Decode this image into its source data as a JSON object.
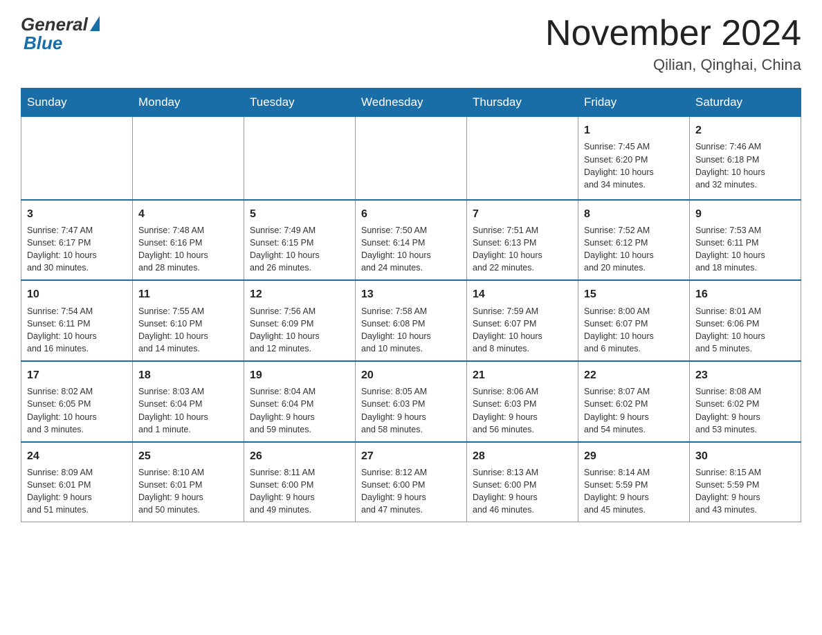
{
  "header": {
    "logo_general": "General",
    "logo_blue": "Blue",
    "month_title": "November 2024",
    "location": "Qilian, Qinghai, China"
  },
  "days_of_week": [
    "Sunday",
    "Monday",
    "Tuesday",
    "Wednesday",
    "Thursday",
    "Friday",
    "Saturday"
  ],
  "weeks": [
    [
      {
        "day": "",
        "info": ""
      },
      {
        "day": "",
        "info": ""
      },
      {
        "day": "",
        "info": ""
      },
      {
        "day": "",
        "info": ""
      },
      {
        "day": "",
        "info": ""
      },
      {
        "day": "1",
        "info": "Sunrise: 7:45 AM\nSunset: 6:20 PM\nDaylight: 10 hours\nand 34 minutes."
      },
      {
        "day": "2",
        "info": "Sunrise: 7:46 AM\nSunset: 6:18 PM\nDaylight: 10 hours\nand 32 minutes."
      }
    ],
    [
      {
        "day": "3",
        "info": "Sunrise: 7:47 AM\nSunset: 6:17 PM\nDaylight: 10 hours\nand 30 minutes."
      },
      {
        "day": "4",
        "info": "Sunrise: 7:48 AM\nSunset: 6:16 PM\nDaylight: 10 hours\nand 28 minutes."
      },
      {
        "day": "5",
        "info": "Sunrise: 7:49 AM\nSunset: 6:15 PM\nDaylight: 10 hours\nand 26 minutes."
      },
      {
        "day": "6",
        "info": "Sunrise: 7:50 AM\nSunset: 6:14 PM\nDaylight: 10 hours\nand 24 minutes."
      },
      {
        "day": "7",
        "info": "Sunrise: 7:51 AM\nSunset: 6:13 PM\nDaylight: 10 hours\nand 22 minutes."
      },
      {
        "day": "8",
        "info": "Sunrise: 7:52 AM\nSunset: 6:12 PM\nDaylight: 10 hours\nand 20 minutes."
      },
      {
        "day": "9",
        "info": "Sunrise: 7:53 AM\nSunset: 6:11 PM\nDaylight: 10 hours\nand 18 minutes."
      }
    ],
    [
      {
        "day": "10",
        "info": "Sunrise: 7:54 AM\nSunset: 6:11 PM\nDaylight: 10 hours\nand 16 minutes."
      },
      {
        "day": "11",
        "info": "Sunrise: 7:55 AM\nSunset: 6:10 PM\nDaylight: 10 hours\nand 14 minutes."
      },
      {
        "day": "12",
        "info": "Sunrise: 7:56 AM\nSunset: 6:09 PM\nDaylight: 10 hours\nand 12 minutes."
      },
      {
        "day": "13",
        "info": "Sunrise: 7:58 AM\nSunset: 6:08 PM\nDaylight: 10 hours\nand 10 minutes."
      },
      {
        "day": "14",
        "info": "Sunrise: 7:59 AM\nSunset: 6:07 PM\nDaylight: 10 hours\nand 8 minutes."
      },
      {
        "day": "15",
        "info": "Sunrise: 8:00 AM\nSunset: 6:07 PM\nDaylight: 10 hours\nand 6 minutes."
      },
      {
        "day": "16",
        "info": "Sunrise: 8:01 AM\nSunset: 6:06 PM\nDaylight: 10 hours\nand 5 minutes."
      }
    ],
    [
      {
        "day": "17",
        "info": "Sunrise: 8:02 AM\nSunset: 6:05 PM\nDaylight: 10 hours\nand 3 minutes."
      },
      {
        "day": "18",
        "info": "Sunrise: 8:03 AM\nSunset: 6:04 PM\nDaylight: 10 hours\nand 1 minute."
      },
      {
        "day": "19",
        "info": "Sunrise: 8:04 AM\nSunset: 6:04 PM\nDaylight: 9 hours\nand 59 minutes."
      },
      {
        "day": "20",
        "info": "Sunrise: 8:05 AM\nSunset: 6:03 PM\nDaylight: 9 hours\nand 58 minutes."
      },
      {
        "day": "21",
        "info": "Sunrise: 8:06 AM\nSunset: 6:03 PM\nDaylight: 9 hours\nand 56 minutes."
      },
      {
        "day": "22",
        "info": "Sunrise: 8:07 AM\nSunset: 6:02 PM\nDaylight: 9 hours\nand 54 minutes."
      },
      {
        "day": "23",
        "info": "Sunrise: 8:08 AM\nSunset: 6:02 PM\nDaylight: 9 hours\nand 53 minutes."
      }
    ],
    [
      {
        "day": "24",
        "info": "Sunrise: 8:09 AM\nSunset: 6:01 PM\nDaylight: 9 hours\nand 51 minutes."
      },
      {
        "day": "25",
        "info": "Sunrise: 8:10 AM\nSunset: 6:01 PM\nDaylight: 9 hours\nand 50 minutes."
      },
      {
        "day": "26",
        "info": "Sunrise: 8:11 AM\nSunset: 6:00 PM\nDaylight: 9 hours\nand 49 minutes."
      },
      {
        "day": "27",
        "info": "Sunrise: 8:12 AM\nSunset: 6:00 PM\nDaylight: 9 hours\nand 47 minutes."
      },
      {
        "day": "28",
        "info": "Sunrise: 8:13 AM\nSunset: 6:00 PM\nDaylight: 9 hours\nand 46 minutes."
      },
      {
        "day": "29",
        "info": "Sunrise: 8:14 AM\nSunset: 5:59 PM\nDaylight: 9 hours\nand 45 minutes."
      },
      {
        "day": "30",
        "info": "Sunrise: 8:15 AM\nSunset: 5:59 PM\nDaylight: 9 hours\nand 43 minutes."
      }
    ]
  ]
}
